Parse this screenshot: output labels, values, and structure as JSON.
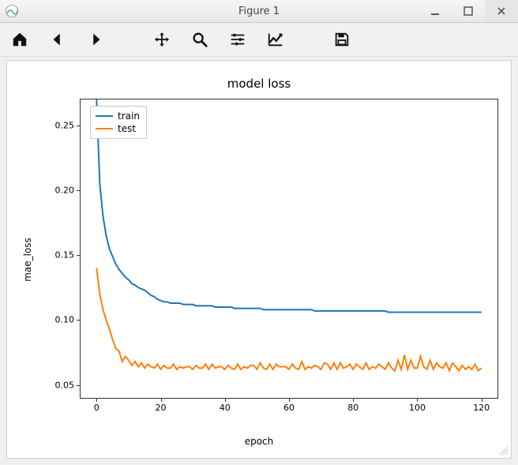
{
  "window": {
    "title": "Figure 1"
  },
  "toolbar": {
    "home": "Home",
    "back": "Back",
    "forward": "Forward",
    "pan": "Pan",
    "zoom": "Zoom",
    "subplots": "Configure subplots",
    "axes": "Edit axis",
    "save": "Save"
  },
  "chart_data": {
    "type": "line",
    "title": "model loss",
    "xlabel": "epoch",
    "ylabel": "mae_loss",
    "xlim": [
      -5,
      125
    ],
    "ylim": [
      0.04,
      0.27
    ],
    "xticks": [
      0,
      20,
      40,
      60,
      80,
      100,
      120
    ],
    "yticks": [
      0.05,
      0.1,
      0.15,
      0.2,
      0.25
    ],
    "legend": {
      "position": "upper left",
      "entries": [
        "train",
        "test"
      ]
    },
    "x": [
      0,
      1,
      2,
      3,
      4,
      5,
      6,
      7,
      8,
      9,
      10,
      11,
      12,
      13,
      14,
      15,
      16,
      17,
      18,
      19,
      20,
      21,
      22,
      23,
      24,
      25,
      26,
      27,
      28,
      29,
      30,
      31,
      32,
      33,
      34,
      35,
      36,
      37,
      38,
      39,
      40,
      41,
      42,
      43,
      44,
      45,
      46,
      47,
      48,
      49,
      50,
      51,
      52,
      53,
      54,
      55,
      56,
      57,
      58,
      59,
      60,
      61,
      62,
      63,
      64,
      65,
      66,
      67,
      68,
      69,
      70,
      71,
      72,
      73,
      74,
      75,
      76,
      77,
      78,
      79,
      80,
      81,
      82,
      83,
      84,
      85,
      86,
      87,
      88,
      89,
      90,
      91,
      92,
      93,
      94,
      95,
      96,
      97,
      98,
      99,
      100,
      101,
      102,
      103,
      104,
      105,
      106,
      107,
      108,
      109,
      110,
      111,
      112,
      113,
      114,
      115,
      116,
      117,
      118,
      119,
      120
    ],
    "series": [
      {
        "name": "train",
        "color": "#1f77b4",
        "values": [
          0.27,
          0.205,
          0.18,
          0.165,
          0.155,
          0.149,
          0.143,
          0.139,
          0.136,
          0.133,
          0.131,
          0.128,
          0.127,
          0.125,
          0.124,
          0.123,
          0.121,
          0.119,
          0.118,
          0.116,
          0.115,
          0.114,
          0.114,
          0.113,
          0.113,
          0.113,
          0.113,
          0.112,
          0.112,
          0.112,
          0.112,
          0.111,
          0.111,
          0.111,
          0.111,
          0.111,
          0.111,
          0.11,
          0.11,
          0.11,
          0.11,
          0.11,
          0.11,
          0.109,
          0.109,
          0.109,
          0.109,
          0.109,
          0.109,
          0.109,
          0.109,
          0.109,
          0.108,
          0.108,
          0.108,
          0.108,
          0.108,
          0.108,
          0.108,
          0.108,
          0.108,
          0.108,
          0.108,
          0.108,
          0.108,
          0.108,
          0.108,
          0.108,
          0.107,
          0.107,
          0.107,
          0.107,
          0.107,
          0.107,
          0.107,
          0.107,
          0.107,
          0.107,
          0.107,
          0.107,
          0.107,
          0.107,
          0.107,
          0.107,
          0.107,
          0.107,
          0.107,
          0.107,
          0.107,
          0.107,
          0.107,
          0.106,
          0.106,
          0.106,
          0.106,
          0.106,
          0.106,
          0.106,
          0.106,
          0.106,
          0.106,
          0.106,
          0.106,
          0.106,
          0.106,
          0.106,
          0.106,
          0.106,
          0.106,
          0.106,
          0.106,
          0.106,
          0.106,
          0.106,
          0.106,
          0.106,
          0.106,
          0.106,
          0.106,
          0.106,
          0.106
        ]
      },
      {
        "name": "test",
        "color": "#ff7f0e",
        "values": [
          0.14,
          0.12,
          0.108,
          0.1,
          0.093,
          0.085,
          0.078,
          0.076,
          0.068,
          0.072,
          0.069,
          0.065,
          0.068,
          0.064,
          0.067,
          0.063,
          0.066,
          0.064,
          0.063,
          0.066,
          0.062,
          0.065,
          0.063,
          0.063,
          0.066,
          0.062,
          0.064,
          0.063,
          0.064,
          0.064,
          0.062,
          0.065,
          0.063,
          0.063,
          0.066,
          0.062,
          0.066,
          0.063,
          0.064,
          0.064,
          0.062,
          0.065,
          0.063,
          0.062,
          0.066,
          0.062,
          0.064,
          0.063,
          0.065,
          0.065,
          0.062,
          0.067,
          0.063,
          0.062,
          0.066,
          0.062,
          0.066,
          0.064,
          0.064,
          0.064,
          0.062,
          0.066,
          0.063,
          0.062,
          0.068,
          0.062,
          0.064,
          0.063,
          0.065,
          0.064,
          0.062,
          0.067,
          0.066,
          0.062,
          0.067,
          0.062,
          0.067,
          0.063,
          0.064,
          0.066,
          0.062,
          0.066,
          0.064,
          0.062,
          0.067,
          0.062,
          0.064,
          0.063,
          0.066,
          0.064,
          0.062,
          0.067,
          0.063,
          0.061,
          0.069,
          0.062,
          0.073,
          0.062,
          0.069,
          0.063,
          0.063,
          0.072,
          0.064,
          0.062,
          0.069,
          0.062,
          0.067,
          0.064,
          0.063,
          0.067,
          0.061,
          0.067,
          0.064,
          0.061,
          0.065,
          0.062,
          0.064,
          0.062,
          0.066,
          0.061,
          0.063
        ]
      }
    ]
  }
}
